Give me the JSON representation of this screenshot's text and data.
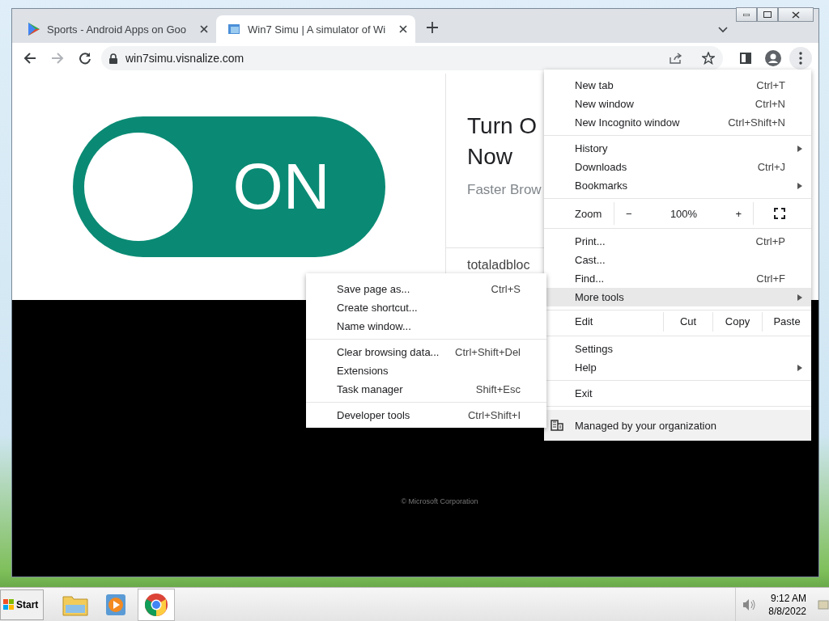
{
  "tabs": [
    {
      "title": "Sports - Android Apps on Goo",
      "kind": "play",
      "selected": false
    },
    {
      "title": "Win7 Simu | A simulator of Wi",
      "kind": "win",
      "selected": true
    }
  ],
  "address_bar": {
    "url": "win7simu.visnalize.com"
  },
  "page": {
    "toggle": {
      "label": "ON",
      "on": true
    },
    "card": {
      "heading": "Turn O",
      "heading_line2": "Now",
      "subtitle": "Faster Brow",
      "footer": "totaladbloc"
    },
    "copyright": "© Microsoft Corporation"
  },
  "menu": {
    "groups": [
      [
        {
          "kind": "item",
          "label": "New tab",
          "shortcut": "Ctrl+T",
          "highlighted": false
        },
        {
          "kind": "item",
          "label": "New window",
          "shortcut": "Ctrl+N",
          "highlighted": false
        },
        {
          "kind": "item",
          "label": "New Incognito window",
          "shortcut": "Ctrl+Shift+N",
          "highlighted": false
        }
      ],
      [
        {
          "kind": "submenu",
          "label": "History",
          "highlighted": false
        },
        {
          "kind": "item",
          "label": "Downloads",
          "shortcut": "Ctrl+J",
          "highlighted": false
        },
        {
          "kind": "submenu",
          "label": "Bookmarks",
          "highlighted": false
        }
      ],
      [
        {
          "kind": "zoom",
          "label": "Zoom",
          "minus": "−",
          "value": "100%",
          "plus": "+"
        }
      ],
      [
        {
          "kind": "item",
          "label": "Print...",
          "shortcut": "Ctrl+P",
          "highlighted": false
        },
        {
          "kind": "item",
          "label": "Cast...",
          "highlighted": false
        },
        {
          "kind": "item",
          "label": "Find...",
          "shortcut": "Ctrl+F",
          "highlighted": false
        },
        {
          "kind": "submenu",
          "label": "More tools",
          "highlighted": true
        },
        {
          "kind": "edit",
          "label": "Edit",
          "buttons": [
            "Cut",
            "Copy",
            "Paste"
          ]
        }
      ],
      [
        {
          "kind": "item",
          "label": "Settings",
          "highlighted": false
        },
        {
          "kind": "submenu",
          "label": "Help",
          "highlighted": false
        }
      ],
      [
        {
          "kind": "item",
          "label": "Exit",
          "highlighted": false
        }
      ],
      [
        {
          "kind": "managed",
          "label": "Managed by your organization"
        }
      ]
    ]
  },
  "submenu": {
    "groups": [
      [
        {
          "label": "Save page as...",
          "shortcut": "Ctrl+S"
        },
        {
          "label": "Create shortcut..."
        },
        {
          "label": "Name window..."
        }
      ],
      [
        {
          "label": "Clear browsing data...",
          "shortcut": "Ctrl+Shift+Del"
        },
        {
          "label": "Extensions"
        },
        {
          "label": "Task manager",
          "shortcut": "Shift+Esc"
        }
      ],
      [
        {
          "label": "Developer tools",
          "shortcut": "Ctrl+Shift+I"
        }
      ]
    ]
  },
  "taskbar": {
    "start": "Start",
    "apps": [
      {
        "kind": "explorer",
        "selected": false
      },
      {
        "kind": "media",
        "selected": false
      },
      {
        "kind": "chrome",
        "selected": true
      }
    ],
    "time": "9:12 AM",
    "date": "8/8/2022"
  }
}
